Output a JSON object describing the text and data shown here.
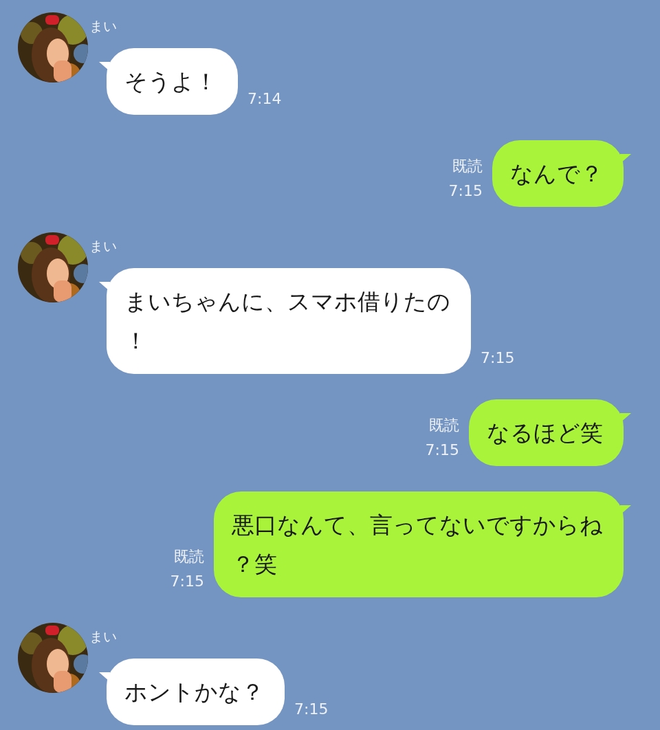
{
  "messages": [
    {
      "kind": "received",
      "sender": "まい",
      "avatar": {
        "kind": "picture"
      },
      "lines": [
        "そうよ！"
      ],
      "time": "7:14"
    },
    {
      "kind": "sent",
      "read": "既読",
      "lines": [
        "なんで？"
      ],
      "time": "7:15"
    },
    {
      "kind": "received",
      "sender": "まい",
      "avatar": {
        "kind": "picture"
      },
      "lines": [
        "まいちゃんに、スマホ借りたの",
        "！"
      ],
      "time": "7:15"
    },
    {
      "kind": "sent",
      "read": "既読",
      "lines": [
        "なるほど笑"
      ],
      "time": "7:15"
    },
    {
      "kind": "sent",
      "read": "既読",
      "lines": [
        "悪口なんて、言ってないですからね",
        "？笑"
      ],
      "time": "7:15"
    },
    {
      "kind": "received",
      "sender": "まい",
      "avatar": {
        "kind": "picture"
      },
      "lines": [
        "ホントかな？"
      ],
      "time": "7:15"
    }
  ]
}
